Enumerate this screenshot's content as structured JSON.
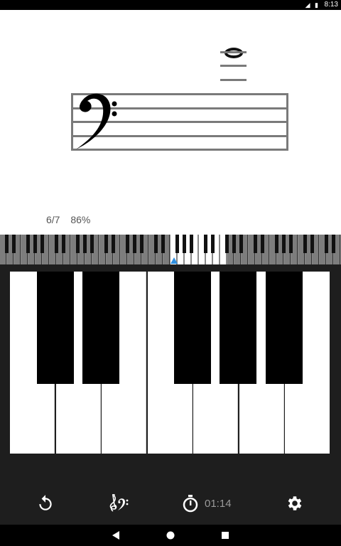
{
  "status_bar": {
    "time": "8:13"
  },
  "score": {
    "clef": "bass",
    "note": "whole note above staff"
  },
  "progress": {
    "count": "6/7",
    "percent": "86%"
  },
  "toolbar": {
    "timer": "01:14"
  },
  "colors": {
    "accent": "#2f8fe0",
    "keyboard_bg": "#1e1e1e",
    "staff": "#7a7a7a"
  }
}
